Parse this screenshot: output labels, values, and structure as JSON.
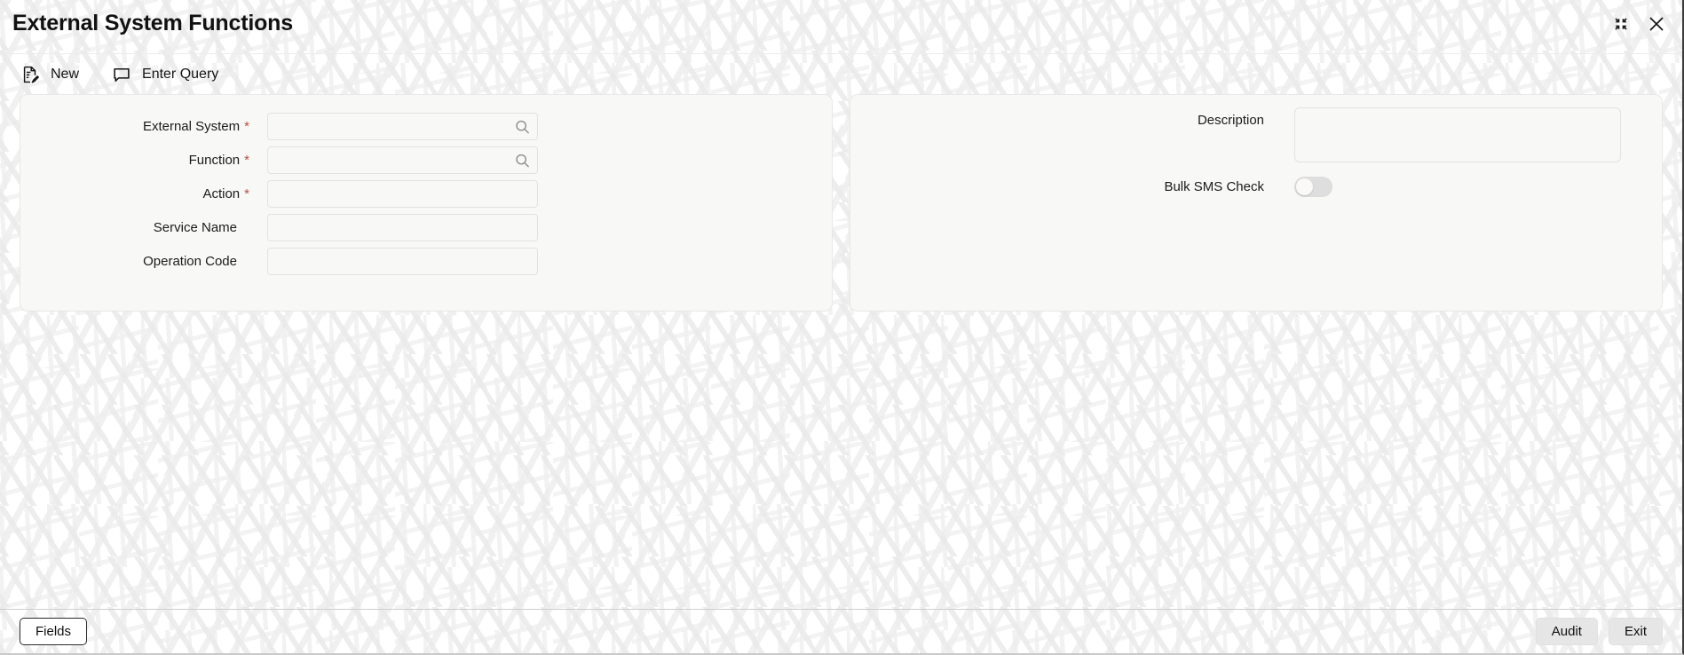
{
  "window": {
    "title": "External System Functions",
    "controls": [
      {
        "name": "collapse-icon",
        "label": "Collapse"
      },
      {
        "name": "close-icon",
        "label": "Close"
      }
    ]
  },
  "toolbar": {
    "items": [
      {
        "label": "New",
        "icon": "new-document-icon"
      },
      {
        "label": "Enter Query",
        "icon": "speech-bubble-icon"
      }
    ]
  },
  "form": {
    "left_panel": {
      "fields": [
        {
          "label": "External System",
          "required": true,
          "value": "",
          "placeholder": "",
          "type": "lookup"
        },
        {
          "label": "Function",
          "required": true,
          "value": "",
          "placeholder": "",
          "type": "lookup"
        },
        {
          "label": "Action",
          "required": true,
          "value": "",
          "placeholder": "",
          "type": "text"
        },
        {
          "label": "Service Name",
          "required": false,
          "value": "",
          "placeholder": "",
          "type": "text"
        },
        {
          "label": "Operation Code",
          "required": false,
          "value": "",
          "placeholder": "",
          "type": "text"
        }
      ]
    },
    "right_panel": {
      "description": {
        "label": "Description",
        "value": "",
        "placeholder": ""
      },
      "bulk_sms_check": {
        "label": "Bulk SMS Check",
        "checked": false
      }
    }
  },
  "footer": {
    "left_buttons": [
      {
        "label": "Fields"
      }
    ],
    "right_buttons": [
      {
        "label": "Audit"
      },
      {
        "label": "Exit"
      }
    ]
  },
  "colors": {
    "required_asterisk": "#b4503f",
    "panel_background": "#f8f8f6",
    "page_background": "#ffffff",
    "text": "#1c1c1c"
  }
}
